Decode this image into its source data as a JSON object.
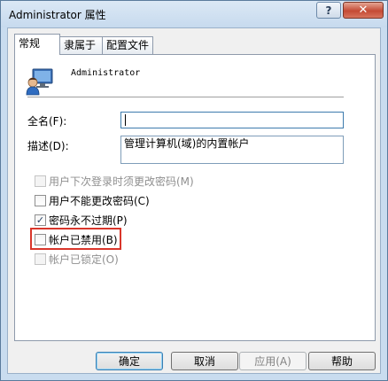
{
  "window": {
    "title": "Administrator 属性",
    "help_button": "?",
    "close_button": "✕"
  },
  "tabs": [
    {
      "label": "常规",
      "selected": true
    },
    {
      "label": "隶属于",
      "selected": false
    },
    {
      "label": "配置文件",
      "selected": false
    }
  ],
  "general": {
    "user_icon": "user-account-icon",
    "user_name": "Administrator",
    "full_name_label": "全名(F):",
    "full_name_value": "",
    "description_label": "描述(D):",
    "description_value": "管理计算机(域)的内置帐户",
    "checkboxes": [
      {
        "label": "用户下次登录时须更改密码(M)",
        "checked": false,
        "enabled": false
      },
      {
        "label": "用户不能更改密码(C)",
        "checked": false,
        "enabled": true
      },
      {
        "label": "密码永不过期(P)",
        "checked": true,
        "enabled": true
      },
      {
        "label": "帐户已禁用(B)",
        "checked": false,
        "enabled": true,
        "highlighted": true
      },
      {
        "label": "帐户已锁定(O)",
        "checked": false,
        "enabled": false
      }
    ]
  },
  "buttons": {
    "ok": "确定",
    "cancel": "取消",
    "apply": "应用(A)",
    "help": "帮助"
  },
  "colors": {
    "highlight_border": "#d9362b",
    "title_bar": "#c9dcef",
    "close_button": "#c44a34"
  }
}
